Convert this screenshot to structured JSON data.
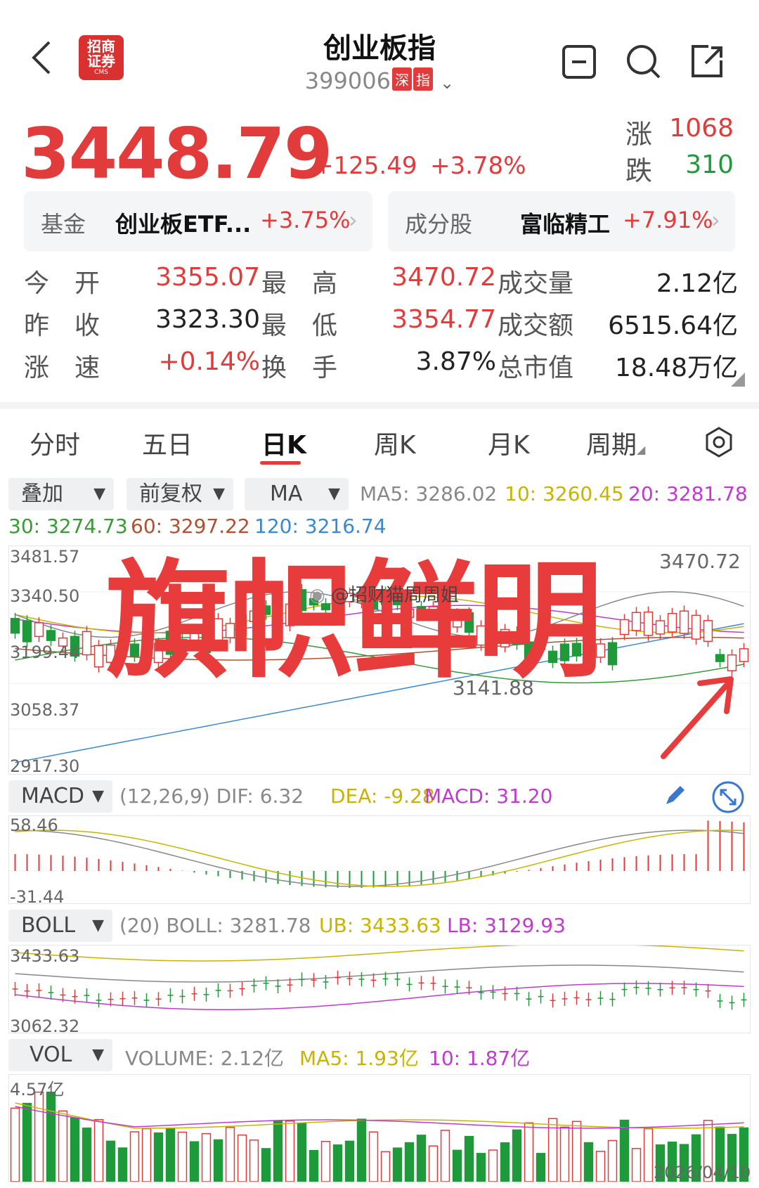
{
  "header": {
    "title": "创业板指",
    "code": "399006",
    "tag1": "深",
    "tag2": "指",
    "logo_text": "招商\n证券",
    "logo_sub": "CMS"
  },
  "quote": {
    "price": "3448.79",
    "change": "+125.49",
    "change_pct": "+3.78%",
    "up_label": "涨",
    "up_count": "1068",
    "down_label": "跌",
    "down_count": "310"
  },
  "fund": {
    "label": "基金",
    "name": "创业板ETF...",
    "pct": "+3.75%"
  },
  "constituent": {
    "label": "成分股",
    "name": "富临精工",
    "pct": "+7.91%"
  },
  "stats": [
    [
      {
        "l": "今　开",
        "v": "3355.07",
        "c": "red"
      },
      {
        "l": "最　高",
        "v": "3470.72",
        "c": "red"
      },
      {
        "l": "成交量",
        "v": "2.12亿",
        "c": ""
      }
    ],
    [
      {
        "l": "昨　收",
        "v": "3323.30",
        "c": ""
      },
      {
        "l": "最　低",
        "v": "3354.77",
        "c": "red"
      },
      {
        "l": "成交额",
        "v": "6515.64亿",
        "c": ""
      }
    ],
    [
      {
        "l": "涨　速",
        "v": "+0.14%",
        "c": "red"
      },
      {
        "l": "换　手",
        "v": "3.87%",
        "c": ""
      },
      {
        "l": "总市值",
        "v": "18.48万亿",
        "c": ""
      }
    ]
  ],
  "tabs": [
    "分时",
    "五日",
    "日K",
    "周K",
    "月K",
    "周期"
  ],
  "controls": {
    "overlay": "叠加",
    "adjust": "前复权",
    "indicator": "MA"
  },
  "ma": {
    "ma5": "MA5: 3286.02",
    "ma10": "10: 3260.45",
    "ma20": "20: 3281.78",
    "ma30": "30: 3274.73",
    "ma60": "60: 3297.22",
    "ma120": "120: 3216.74"
  },
  "kline_axis": [
    "3481.57",
    "3340.50",
    "3199.44",
    "3058.37",
    "2917.30"
  ],
  "kline_high_label": "3470.72",
  "kline_low_label": "3141.88",
  "overlay_caption": "旗帜鲜明",
  "watermark": "@招财猫周周姐",
  "macd": {
    "name": "MACD",
    "params": "(12,26,9) DIF: 6.32",
    "dea": "DEA: -9.28",
    "macd": "MACD: 31.20",
    "top": "58.46",
    "bottom": "-31.44"
  },
  "boll": {
    "name": "BOLL",
    "params": "(20) BOLL: 3281.78",
    "ub": "UB: 3433.63",
    "lb": "LB: 3129.93",
    "top": "3433.63",
    "bottom": "3062.32"
  },
  "vol": {
    "name": "VOL",
    "volume": "VOLUME: 2.12亿",
    "ma5": "MA5: 1.93亿",
    "ma10": "10: 1.87亿",
    "top": "4.57亿",
    "date": "2026/04/10"
  },
  "colors": {
    "up": "#e23b3b",
    "down": "#1f9a3a",
    "ma5": "#888888",
    "ma10": "#c8b400",
    "ma20": "#c03ad0",
    "ma30": "#3a9a3a",
    "ma60": "#b05030",
    "ma120": "#3a88d0"
  }
}
